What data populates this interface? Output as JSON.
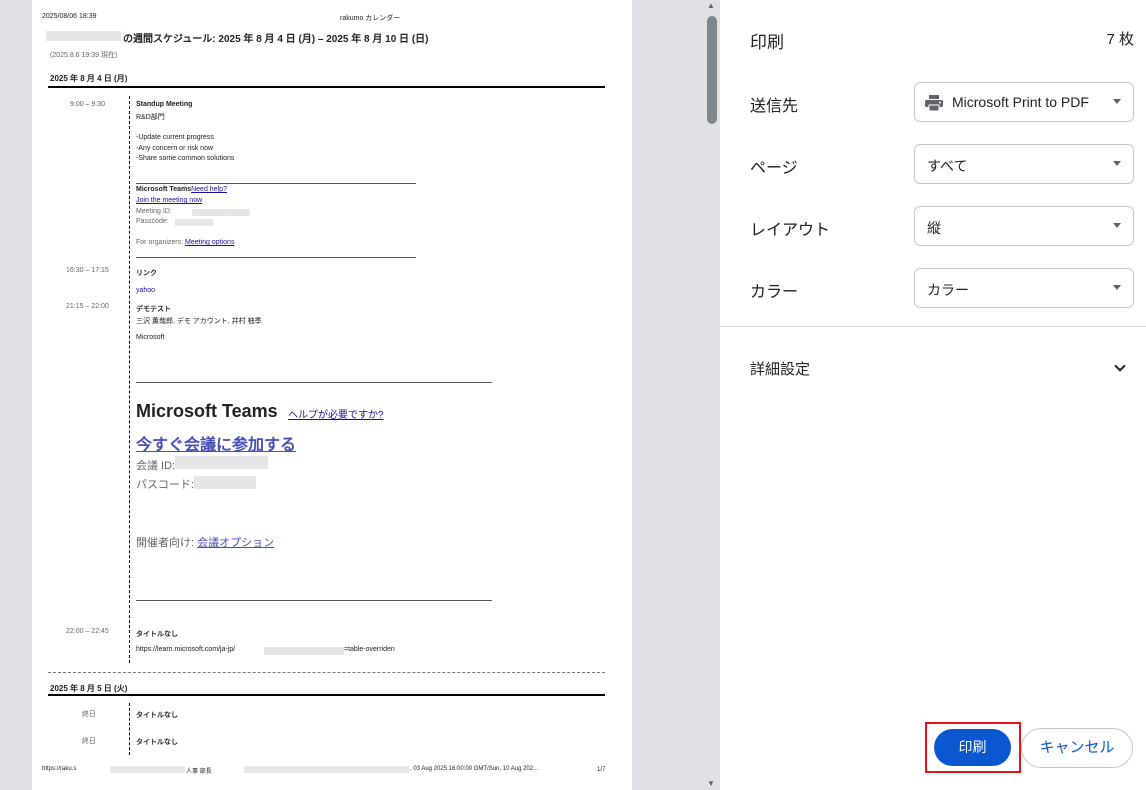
{
  "preview": {
    "header": {
      "datetime": "2025/08/06 18:39",
      "app_name": "rakumo カレンダー"
    },
    "doc_title": "の週間スケジュール: 2025 年 8 月 4 日 (月) – 2025 年 8 月 10 日 (日)",
    "as_of": "(2025.8.6 19:39 現在)",
    "days": [
      {
        "heading": "2025 年 8 月 4 日 (月)"
      },
      {
        "heading": "2025 年 8 月 5 日 (火)"
      }
    ],
    "events": {
      "e1": {
        "time": "9:00 – 9:30",
        "title": "Standup Meeting",
        "dept": "R&D部門",
        "agenda": [
          "-Update current progress",
          "-Any concern or risk now",
          "-Share some common solutions"
        ],
        "teams_label": "Microsoft Teams",
        "need_help": "Need help?",
        "join": "Join the meeting now",
        "meeting_id_label": "Meeting ID: ",
        "passcode_label": "Passcode: ",
        "organizers_label": "For organizers: ",
        "meeting_options": "Meeting options"
      },
      "e2": {
        "time": "16:30 – 17:15",
        "title": "リンク",
        "link": "yahoo"
      },
      "e3": {
        "time": "21:15 – 22:00",
        "title": "デモテスト",
        "attendees": "三沢 薫哉郎, デモ アカウント, 井村 柚季",
        "org": "Microsoft",
        "teams_big": "Microsoft Teams",
        "help_link": "ヘルプが必要ですか?",
        "join_big": "今すぐ会議に参加する",
        "meeting_id_label": "会議 ID: ",
        "passcode_label": "パスコード: ",
        "organizers_label": "開催者向け: ",
        "meeting_options": "会議オプション"
      },
      "e4": {
        "time": "22:00 – 22:45",
        "title": "タイトルなし",
        "url_start": "https://learn.microsoft.com/ja-jp/",
        "url_end": "=table-overriden"
      },
      "e5": {
        "time": "終日",
        "title": "タイトルなし"
      },
      "e6": {
        "time": "終日",
        "title": "タイトルなし"
      }
    },
    "footer": {
      "url": "https://raku.s",
      "mid": "人事 部長",
      "dates": ", 03 Aug 2025 16:00:00 GMT/Sun, 10 Aug 202...",
      "page_no": "1/7"
    }
  },
  "panel": {
    "title": "印刷",
    "sheet_count": "7 枚",
    "destination": {
      "label": "送信先",
      "value": "Microsoft Print to PDF",
      "icon": "printer-icon"
    },
    "pages": {
      "label": "ページ",
      "value": "すべて"
    },
    "layout": {
      "label": "レイアウト",
      "value": "縦"
    },
    "color": {
      "label": "カラー",
      "value": "カラー"
    },
    "more_settings": {
      "label": "詳細設定",
      "icon": "chevron-down-icon"
    },
    "print_button": "印刷",
    "cancel_button": "キャンセル",
    "accent_color": "#0b57d0",
    "highlight_color": "#e8101b"
  }
}
